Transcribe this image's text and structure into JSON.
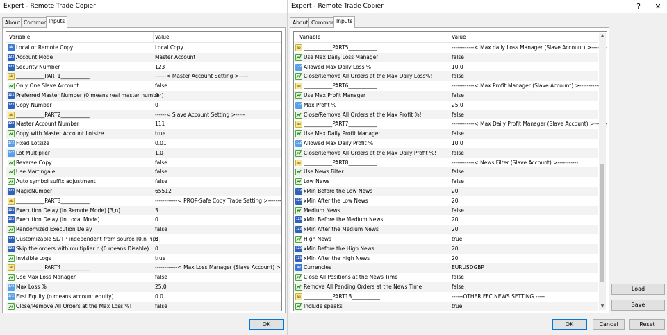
{
  "left": {
    "title": "Expert - Remote Trade Copier",
    "tabs": [
      "About",
      "Common",
      "Inputs"
    ],
    "active_tab": 2,
    "headers": {
      "variable": "Variable",
      "value": "Value"
    },
    "ok_label": "OK",
    "rows": [
      {
        "k": "str",
        "name": "Local or Remote Copy",
        "value": "Local Copy"
      },
      {
        "k": "num",
        "name": "Account Mode",
        "value": "Master Account"
      },
      {
        "k": "num",
        "name": "Security Number",
        "value": "123"
      },
      {
        "k": "sep",
        "name": "___________PART1___________",
        "value": "------< Master Account Setting >-----"
      },
      {
        "k": "bool",
        "name": "Only One Slave Account",
        "value": "false"
      },
      {
        "k": "num",
        "name": "Preferred Master Number (0 means real master number)",
        "value": "0"
      },
      {
        "k": "num",
        "name": "Copy Number",
        "value": "0"
      },
      {
        "k": "sep",
        "name": "___________PART2___________",
        "value": "------< Slave Account Setting >-----"
      },
      {
        "k": "num",
        "name": "Master Account Number",
        "value": "111"
      },
      {
        "k": "bool",
        "name": "Copy with Master Account Lotsize",
        "value": "true"
      },
      {
        "k": "dbl",
        "name": "Fixed Lotsize",
        "value": "0.01"
      },
      {
        "k": "dbl",
        "name": "Lot Multiplier",
        "value": "1.0"
      },
      {
        "k": "bool",
        "name": "Reverse Copy",
        "value": "false"
      },
      {
        "k": "bool",
        "name": "Use Martingale",
        "value": "false"
      },
      {
        "k": "bool",
        "name": "Auto symbol suffix adjustment",
        "value": "false"
      },
      {
        "k": "num",
        "name": "MagicNumber",
        "value": "65512"
      },
      {
        "k": "sep",
        "name": "___________PART3___________",
        "value": "------------< PROP-Safe Copy Trade Setting >-----------"
      },
      {
        "k": "num",
        "name": "Execution Delay (in Remote Mode) [3,n]",
        "value": "3"
      },
      {
        "k": "num",
        "name": "Execution Delay (in Local Mode)",
        "value": "0"
      },
      {
        "k": "bool",
        "name": "Randomized Execution Delay",
        "value": "false"
      },
      {
        "k": "num",
        "name": "Customizable SL/TP independent from source [0,n Pips]",
        "value": "0"
      },
      {
        "k": "num",
        "name": "Skip the orders with multiplier n (0 means Disable)",
        "value": "0"
      },
      {
        "k": "bool",
        "name": "Invisible Logs",
        "value": "true"
      },
      {
        "k": "sep",
        "name": "___________PART4___________",
        "value": "------------< Max Loss Manager (Slave Account) >-----------"
      },
      {
        "k": "bool",
        "name": "Use Max Loss Manager",
        "value": "false"
      },
      {
        "k": "dbl",
        "name": "Max Loss %",
        "value": "25.0"
      },
      {
        "k": "dbl",
        "name": "First Equity (o means account equity)",
        "value": "0.0"
      },
      {
        "k": "bool",
        "name": "Close/Remove All Orders at the Max Loss %!",
        "value": "false"
      }
    ]
  },
  "right": {
    "title": "Expert - Remote Trade Copier",
    "help_label": "?",
    "close_label": "✕",
    "tabs": [
      "About",
      "Common",
      "Inputs"
    ],
    "active_tab": 2,
    "headers": {
      "variable": "Variable",
      "value": "Value"
    },
    "load_label": "Load",
    "save_label": "Save",
    "ok_label": "OK",
    "cancel_label": "Cancel",
    "reset_label": "Reset",
    "rows": [
      {
        "k": "sep",
        "name": "___________PART5___________",
        "value": "------------< Max daily Loss Manager (Slave Account) >-----------"
      },
      {
        "k": "bool",
        "name": "Use Max Daily Loss Manager",
        "value": "false"
      },
      {
        "k": "dbl",
        "name": "Allowed Max Daily Loss %",
        "value": "10.0"
      },
      {
        "k": "bool",
        "name": "Close/Remove All Orders at the Max Daily Loss%!",
        "value": "false"
      },
      {
        "k": "sep",
        "name": "___________PART6___________",
        "value": "------------< Max Profit Manager (Slave Account) >-----------"
      },
      {
        "k": "bool",
        "name": "Use Max Profit Manager",
        "value": "false"
      },
      {
        "k": "dbl",
        "name": "Max Profit %",
        "value": "25.0"
      },
      {
        "k": "bool",
        "name": "Close/Remove All Orders at the Max Profit %!",
        "value": "false"
      },
      {
        "k": "sep",
        "name": "___________PART7___________",
        "value": "------------< Max Daily Profit Manager (Slave Account) >-----------"
      },
      {
        "k": "bool",
        "name": "Use Max Daily Profit Manager",
        "value": "false"
      },
      {
        "k": "dbl",
        "name": "Allowed Max Daily Profit %",
        "value": "10.0"
      },
      {
        "k": "bool",
        "name": "Close/Remove All Orders at the Max Daily Profit %!",
        "value": "false"
      },
      {
        "k": "sep",
        "name": "___________PART8___________",
        "value": "------------< News Filter (Slave Account) >-----------"
      },
      {
        "k": "bool",
        "name": "Use News Filter",
        "value": "false"
      },
      {
        "k": "bool",
        "name": "Low News",
        "value": "false"
      },
      {
        "k": "num",
        "name": "xMin Before the Low News",
        "value": "20"
      },
      {
        "k": "num",
        "name": "xMin After the Low News",
        "value": "20"
      },
      {
        "k": "bool",
        "name": "Medium News",
        "value": "false"
      },
      {
        "k": "num",
        "name": "xMin Before the Medium News",
        "value": "20"
      },
      {
        "k": "num",
        "name": "xMin After the Medium News",
        "value": "20"
      },
      {
        "k": "bool",
        "name": "High News",
        "value": "true"
      },
      {
        "k": "num",
        "name": "xMin Before the High News",
        "value": "20"
      },
      {
        "k": "num",
        "name": "xMin After the High News",
        "value": "20"
      },
      {
        "k": "str",
        "name": "Currencies",
        "value": "EURUSDGBP"
      },
      {
        "k": "bool",
        "name": "Close All Positions at the News Time",
        "value": "false"
      },
      {
        "k": "bool",
        "name": "Remove All Pending Orders at the News Time",
        "value": "false"
      },
      {
        "k": "sep",
        "name": "___________PART13___________",
        "value": "------OTHER FFC NEWS SETTING -----"
      },
      {
        "k": "bool",
        "name": "Include speaks",
        "value": "true"
      }
    ]
  }
}
